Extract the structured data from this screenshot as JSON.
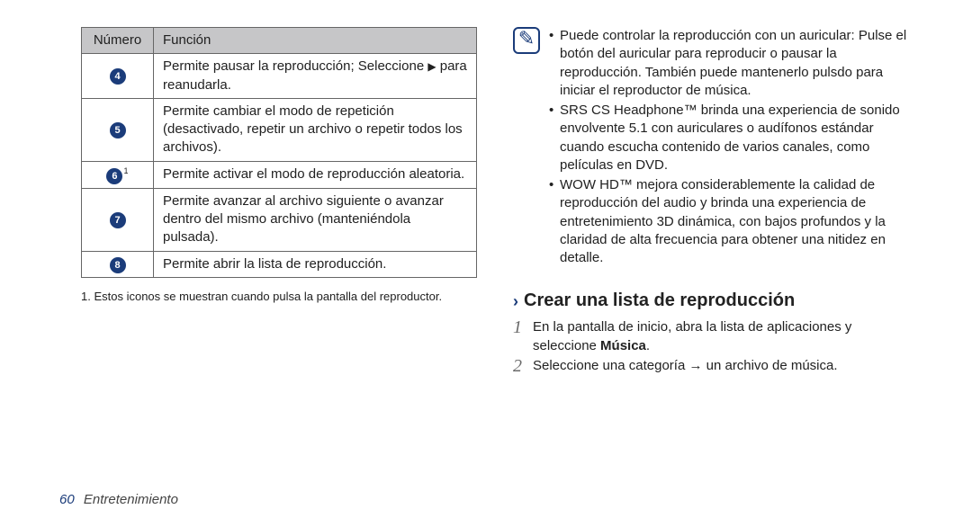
{
  "table": {
    "header_num": "Número",
    "header_fn": "Función",
    "rows": [
      {
        "n": "4",
        "sup": "",
        "fn_pre": "Permite pausar la reproducción; Seleccione ",
        "fn_post": " para reanudarla."
      },
      {
        "n": "5",
        "sup": "",
        "fn": "Permite cambiar el modo de repetición (desactivado, repetir un archivo o repetir todos los archivos)."
      },
      {
        "n": "6",
        "sup": "1",
        "fn": "Permite activar el modo de reproducción aleatoria."
      },
      {
        "n": "7",
        "sup": "",
        "fn": "Permite avanzar al archivo siguiente o avanzar dentro del mismo archivo (manteniéndola pulsada)."
      },
      {
        "n": "8",
        "sup": "",
        "fn": "Permite abrir la lista de reproducción."
      }
    ]
  },
  "footnote": "1.  Estos iconos se muestran cuando pulsa la pantalla del reproductor.",
  "note_icon": "✎",
  "note_items": [
    "Puede controlar la reproducción con un auricular: Pulse el botón del auricular para reproducir o pausar la reproducción. También puede mantenerlo pulsdo para iniciar el reproductor de música.",
    "SRS CS Headphone™ brinda una experiencia de sonido envolvente 5.1 con auriculares o audífonos estándar cuando escucha contenido de varios canales, como películas en DVD.",
    "WOW HD™ mejora considerablemente la calidad de reproducción del audio y brinda una experiencia de entretenimiento 3D dinámica, con bajos profundos y la claridad de alta frecuencia para obtener una nitidez en detalle."
  ],
  "section": {
    "chev": "›",
    "title": "Crear una lista de reproducción",
    "step1_pre": "En la pantalla de inicio, abra la lista de aplicaciones y seleccione ",
    "step1_bold": "Música",
    "step1_post": ".",
    "step2": "Seleccione una categoría → un archivo de música."
  },
  "footer": {
    "page": "60",
    "section": "Entretenimiento"
  }
}
